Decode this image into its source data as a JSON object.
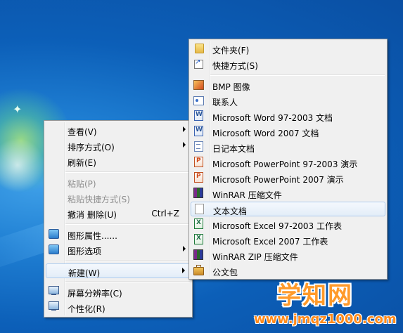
{
  "context_menu": {
    "items": [
      {
        "label": "查看(V)",
        "submenu": true
      },
      {
        "label": "排序方式(O)",
        "submenu": true
      },
      {
        "label": "刷新(E)"
      },
      {
        "label": "粘贴(P)",
        "disabled": true
      },
      {
        "label": "粘贴快捷方式(S)",
        "disabled": true
      },
      {
        "label": "撤消 删除(U)",
        "shortcut": "Ctrl+Z"
      },
      {
        "label": "图形属性......",
        "icon": "graphics-icon"
      },
      {
        "label": "图形选项",
        "icon": "graphics-icon",
        "submenu": true
      },
      {
        "label": "新建(W)",
        "submenu": true,
        "highlighted": true
      },
      {
        "label": "屏幕分辨率(C)",
        "icon": "screen-icon"
      },
      {
        "label": "个性化(R)",
        "icon": "screen-icon"
      }
    ]
  },
  "new_submenu": {
    "items": [
      {
        "label": "文件夹(F)",
        "icon": "folder-icon"
      },
      {
        "label": "快捷方式(S)",
        "icon": "shortcut-icon"
      },
      {
        "label": "BMP 图像",
        "icon": "bmp-image-icon"
      },
      {
        "label": "联系人",
        "icon": "contact-icon"
      },
      {
        "label": "Microsoft Word 97-2003 文档",
        "icon": "word-doc-icon"
      },
      {
        "label": "Microsoft Word 2007 文档",
        "icon": "word-doc-icon"
      },
      {
        "label": "日记本文档",
        "icon": "journal-icon"
      },
      {
        "label": "Microsoft PowerPoint 97-2003 演示",
        "icon": "powerpoint-icon"
      },
      {
        "label": "Microsoft PowerPoint 2007 演示",
        "icon": "powerpoint-icon"
      },
      {
        "label": "WinRAR 压缩文件",
        "icon": "winrar-icon"
      },
      {
        "label": "文本文档",
        "icon": "text-file-icon",
        "highlighted": true
      },
      {
        "label": "Microsoft Excel 97-2003 工作表",
        "icon": "excel-icon"
      },
      {
        "label": "Microsoft Excel 2007 工作表",
        "icon": "excel-icon"
      },
      {
        "label": "WinRAR ZIP 压缩文件",
        "icon": "winrar-zip-icon"
      },
      {
        "label": "公文包",
        "icon": "briefcase-icon"
      }
    ]
  },
  "watermark": {
    "brand": "学知网",
    "url": "www.jmqz1000.com"
  }
}
